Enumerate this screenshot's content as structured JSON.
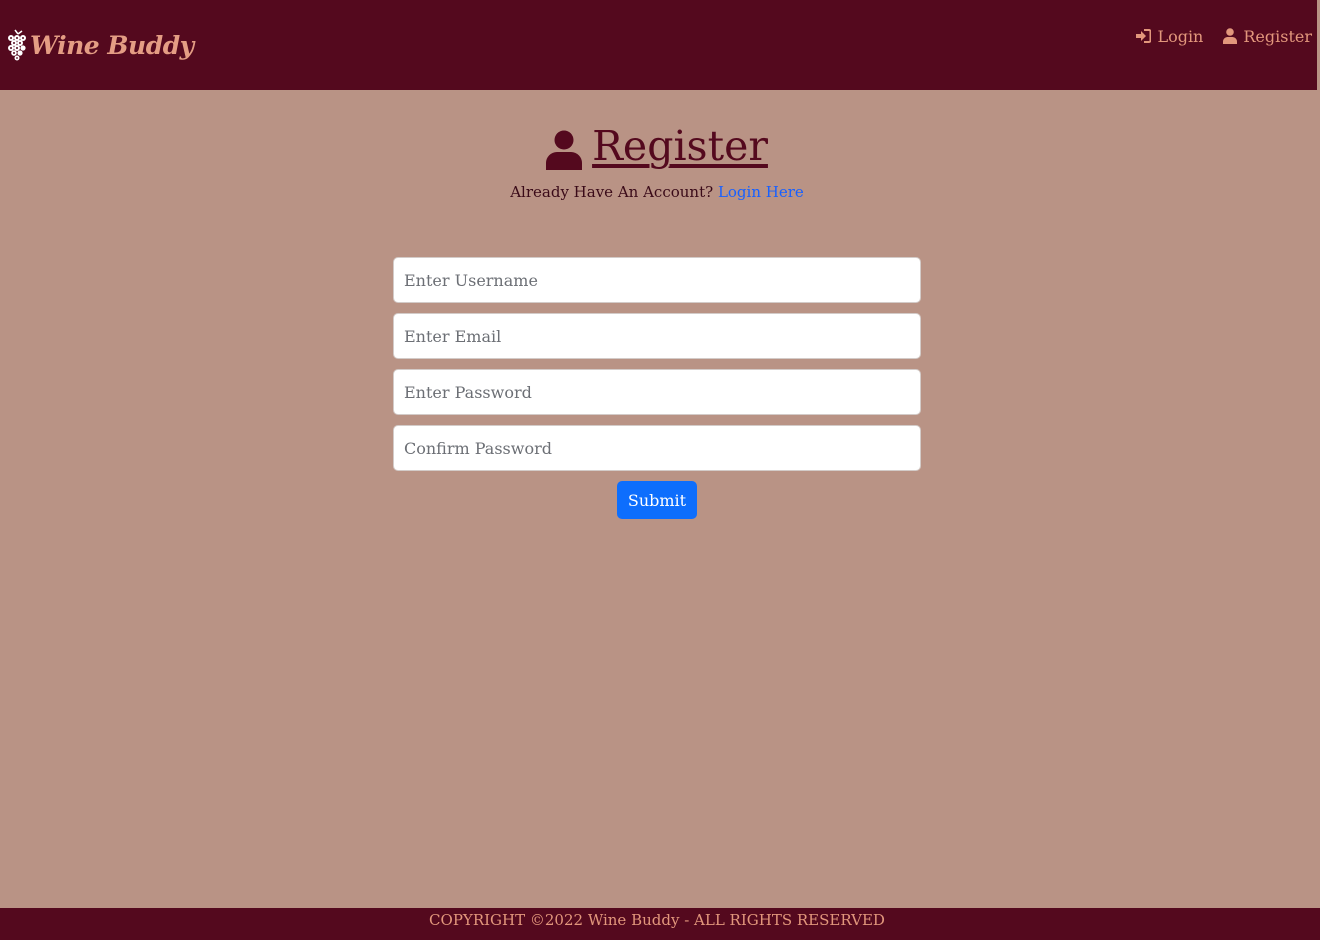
{
  "colors": {
    "navbar_bg": "#54091e",
    "page_bg": "#b99385",
    "nav_link": "#e2977c",
    "brand": "#e49d84",
    "title": "#54091e",
    "link": "#1760ff",
    "submit_bg": "#0d6efd"
  },
  "navbar": {
    "brand_text": "Wine Buddy",
    "brand_icon": "grapes-icon",
    "links": [
      {
        "label": "Login",
        "icon": "sign-in-icon"
      },
      {
        "label": "Register",
        "icon": "user-icon"
      }
    ]
  },
  "main": {
    "title": " Register",
    "title_icon": "user-icon",
    "subtitle_text": "Already Have An Account?",
    "subtitle_link": "Login Here"
  },
  "form": {
    "fields": [
      {
        "placeholder": "Enter Username",
        "value": ""
      },
      {
        "placeholder": "Enter Email",
        "value": ""
      },
      {
        "placeholder": "Enter Password",
        "value": ""
      },
      {
        "placeholder": "Confirm Password",
        "value": ""
      }
    ],
    "submit_label": "Submit"
  },
  "footer": {
    "text": "COPYRIGHT ©2022 Wine Buddy - ALL RIGHTS RESERVED"
  }
}
